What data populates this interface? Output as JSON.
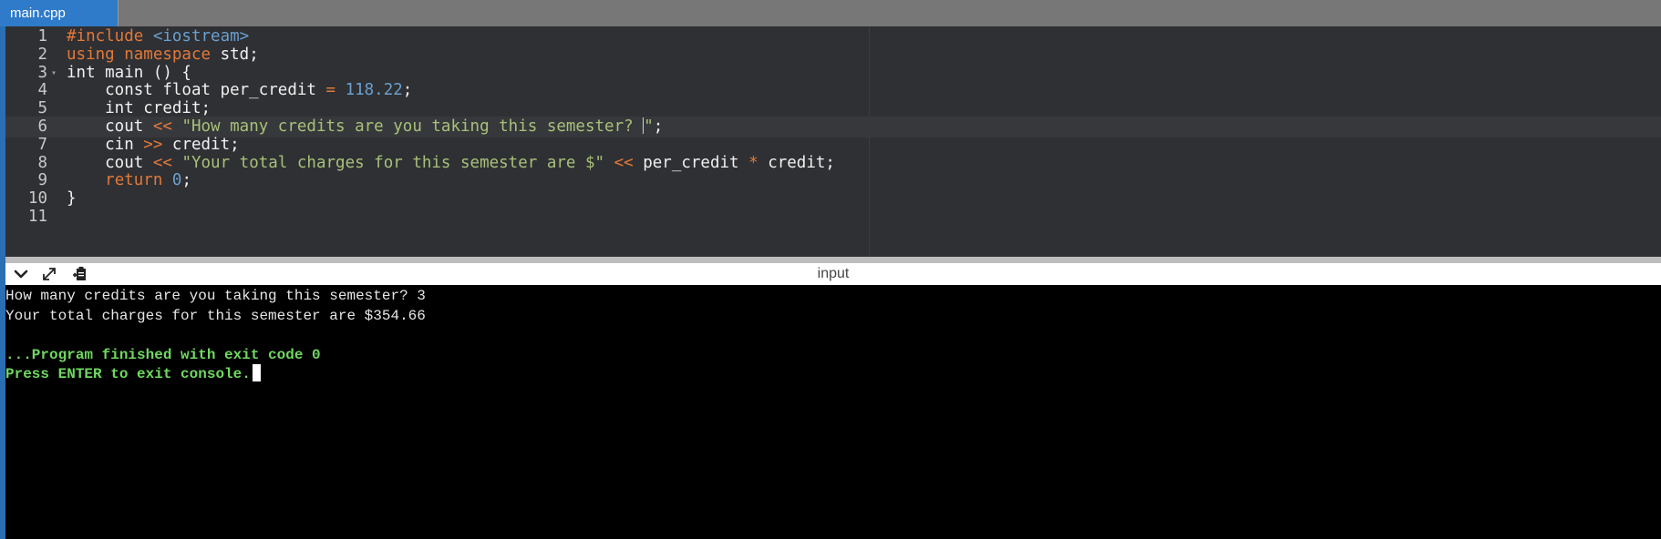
{
  "tabs": [
    {
      "label": "main.cpp",
      "active": true
    }
  ],
  "editor": {
    "active_line": 6,
    "lines": [
      {
        "n": "1",
        "tokens": [
          {
            "t": "#include ",
            "c": "pre"
          },
          {
            "t": "<iostream>",
            "c": "inc"
          }
        ]
      },
      {
        "n": "2",
        "tokens": [
          {
            "t": "using namespace",
            "c": "kw"
          },
          {
            "t": " std;",
            "c": "plain"
          }
        ]
      },
      {
        "n": "3",
        "fold": true,
        "tokens": [
          {
            "t": "int main () {",
            "c": "plain"
          }
        ]
      },
      {
        "n": "4",
        "tokens": [
          {
            "t": "    const float per_credit ",
            "c": "plain"
          },
          {
            "t": "=",
            "c": "op"
          },
          {
            "t": " ",
            "c": "plain"
          },
          {
            "t": "118.22",
            "c": "num"
          },
          {
            "t": ";",
            "c": "plain"
          }
        ]
      },
      {
        "n": "5",
        "tokens": [
          {
            "t": "    int credit;",
            "c": "plain"
          }
        ]
      },
      {
        "n": "6",
        "tokens": [
          {
            "t": "    cout ",
            "c": "plain"
          },
          {
            "t": "<<",
            "c": "op"
          },
          {
            "t": " ",
            "c": "plain"
          },
          {
            "t": "\"How many credits are you taking this semester? ",
            "c": "str"
          },
          {
            "t": "",
            "c": "cursor"
          },
          {
            "t": "\"",
            "c": "str"
          },
          {
            "t": ";",
            "c": "plain"
          }
        ]
      },
      {
        "n": "7",
        "tokens": [
          {
            "t": "    cin ",
            "c": "plain"
          },
          {
            "t": ">>",
            "c": "op"
          },
          {
            "t": " credit;",
            "c": "plain"
          }
        ]
      },
      {
        "n": "8",
        "tokens": [
          {
            "t": "    cout ",
            "c": "plain"
          },
          {
            "t": "<<",
            "c": "op"
          },
          {
            "t": " ",
            "c": "plain"
          },
          {
            "t": "\"Your total charges for this semester are $\"",
            "c": "str"
          },
          {
            "t": " ",
            "c": "plain"
          },
          {
            "t": "<<",
            "c": "op"
          },
          {
            "t": " per_credit ",
            "c": "plain"
          },
          {
            "t": "*",
            "c": "op"
          },
          {
            "t": " credit;",
            "c": "plain"
          }
        ]
      },
      {
        "n": "9",
        "tokens": [
          {
            "t": "    ",
            "c": "plain"
          },
          {
            "t": "return",
            "c": "kw"
          },
          {
            "t": " ",
            "c": "plain"
          },
          {
            "t": "0",
            "c": "num"
          },
          {
            "t": ";",
            "c": "plain"
          }
        ]
      },
      {
        "n": "10",
        "tokens": [
          {
            "t": "}",
            "c": "plain"
          }
        ]
      },
      {
        "n": "11",
        "tokens": []
      }
    ]
  },
  "io_panel": {
    "label": "input",
    "buttons": [
      {
        "name": "collapse-console-button",
        "icon": "chevron-down-icon"
      },
      {
        "name": "expand-console-button",
        "icon": "expand-icon"
      },
      {
        "name": "copy-output-button",
        "icon": "clipboard-icon"
      }
    ]
  },
  "console": {
    "lines": [
      {
        "text": "How many credits are you taking this semester? 3",
        "style": "normal"
      },
      {
        "text": "Your total charges for this semester are $354.66",
        "style": "normal"
      },
      {
        "text": "",
        "style": "normal"
      },
      {
        "text": "...Program finished with exit code 0",
        "style": "green"
      },
      {
        "text": "Press ENTER to exit console.",
        "style": "green",
        "cursor": true
      }
    ]
  },
  "colors": {
    "tab_active": "#2f7bc9",
    "editor_bg": "#2f3033",
    "keyword": "#e2793a",
    "number": "#6a9fd0",
    "string": "#a8c07a",
    "console_green": "#6fd860"
  }
}
